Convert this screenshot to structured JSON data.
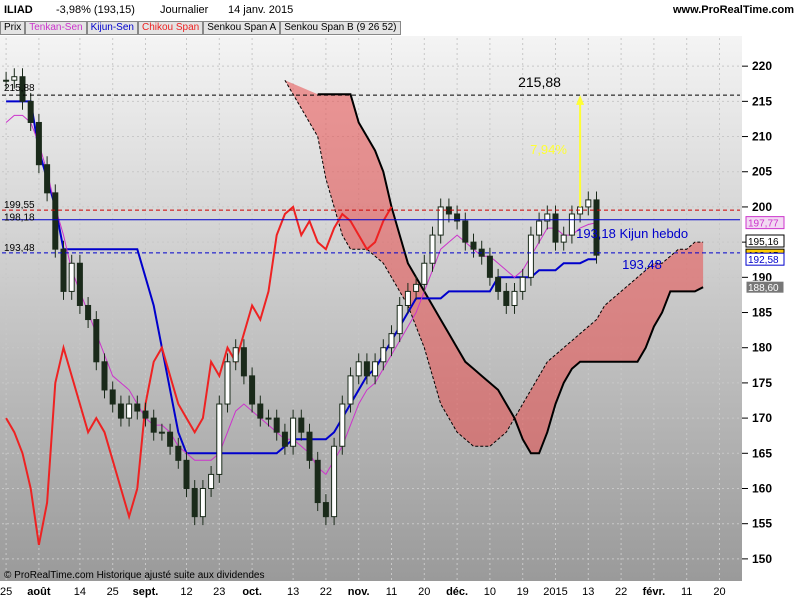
{
  "header": {
    "symbol": "ILIAD",
    "change": "-3,98% (193,15)",
    "period": "Journalier",
    "date": "14 janv. 2015",
    "site": "www.ProRealTime.com"
  },
  "legend": [
    {
      "label": "Prix",
      "color": "#000000"
    },
    {
      "label": "Tenkan-Sen",
      "color": "#cc33cc"
    },
    {
      "label": "Kijun-Sen",
      "color": "#0000cc"
    },
    {
      "label": "Chikou Span",
      "color": "#ee2222"
    },
    {
      "label": "Senkou Span A",
      "color": "#000000"
    },
    {
      "label": "Senkou Span B (9 26 52)",
      "color": "#000000"
    }
  ],
  "footer": "© ProRealTime.com  Historique ajusté suite aux dividendes",
  "annotations": {
    "target": "215,88",
    "percent": "7,94%",
    "kijun_hebdo": "193,18 Kijun hebdo",
    "support": "193,48",
    "left_215": "215,88",
    "left_19955": "199,55",
    "left_19818": "198,18",
    "left_19348": "193,48"
  },
  "price_tags": [
    {
      "text": "197,77",
      "value": 197.77,
      "color": "#cc33cc",
      "fill": "#f2d9f2"
    },
    {
      "text": "195,16",
      "value": 195.16,
      "color": "#000000",
      "fill": "#ffffff"
    },
    {
      "text": "193,15",
      "value": 193.15,
      "color": "#000000",
      "fill": "#ffcc00"
    },
    {
      "text": "192,58",
      "value": 192.58,
      "color": "#0000cc",
      "fill": "#ffffff"
    },
    {
      "text": "188,60",
      "value": 188.6,
      "color": "#ffffff",
      "fill": "#777777"
    }
  ],
  "colors": {
    "bull_cloud": "#6f9a55",
    "bear_cloud": "#e84c4c",
    "tenkan": "#cc33cc",
    "kijun": "#0000cc",
    "chikou": "#ee2222",
    "target_arrow": "#ffff33"
  },
  "chart_data": {
    "type": "line",
    "title": "ILIAD",
    "ylim": [
      147,
      224
    ],
    "y_ticks": [
      150,
      155,
      160,
      165,
      170,
      175,
      180,
      185,
      190,
      195,
      200,
      205,
      210,
      215,
      220
    ],
    "x_ticks": [
      "25",
      "août",
      "14",
      "25",
      "sept.",
      "12",
      "23",
      "oct.",
      "13",
      "22",
      "nov.",
      "11",
      "20",
      "déc.",
      "10",
      "19",
      "2015",
      "13",
      "22",
      "févr.",
      "11",
      "20"
    ],
    "x_index": [
      0,
      4,
      9,
      13,
      17,
      22,
      26,
      30,
      35,
      39,
      43,
      47,
      51,
      55,
      59,
      63,
      67,
      71,
      75,
      79,
      83,
      87
    ],
    "x_count": 90,
    "candles_close": [
      218,
      218.5,
      215,
      212,
      206,
      202,
      194,
      188,
      192,
      186,
      184,
      178,
      174,
      172,
      170,
      172,
      171,
      170,
      168,
      168,
      166,
      164,
      160,
      156,
      160,
      162,
      172,
      178,
      180,
      176,
      172,
      170,
      170,
      168,
      166,
      170,
      168,
      164,
      158,
      156,
      166,
      172,
      176,
      178,
      176,
      178,
      180,
      182,
      186,
      188,
      189,
      192,
      196,
      200,
      199,
      198,
      195,
      194,
      193,
      190,
      188,
      186,
      188,
      190,
      196,
      198,
      199,
      195,
      196,
      199,
      200,
      201,
      193.15
    ],
    "tenkan": [
      212,
      213,
      213,
      212,
      209,
      205,
      200,
      196,
      191,
      188,
      185,
      182,
      179,
      176,
      175,
      174,
      172,
      170,
      169,
      169,
      168,
      166,
      165,
      164,
      164,
      164,
      165,
      168,
      171,
      172,
      171,
      170,
      169,
      168,
      167,
      167,
      166,
      165,
      163,
      162,
      164,
      166,
      169,
      172,
      174,
      175,
      177,
      179,
      181,
      183,
      185,
      188,
      191,
      194,
      195,
      196,
      195,
      194,
      193,
      193,
      192,
      191,
      190,
      191,
      193,
      195,
      197,
      197,
      196,
      196,
      197,
      197.5,
      197.77
    ],
    "kijun": [
      215,
      215,
      215,
      215,
      208,
      204,
      200,
      194,
      194,
      194,
      194,
      194,
      194,
      194,
      194,
      194,
      194,
      190,
      186,
      180,
      174,
      168,
      165,
      165,
      165,
      165,
      165,
      165,
      165,
      165,
      165,
      165,
      165,
      165,
      166,
      167,
      167,
      167,
      167,
      167,
      168,
      170,
      172,
      174,
      176,
      177,
      179,
      181,
      183,
      185,
      187,
      187,
      187,
      187,
      188,
      188,
      188,
      188,
      188,
      188,
      190,
      190,
      190,
      190,
      190,
      191,
      191,
      191,
      192,
      192,
      192,
      192.58,
      192.58
    ],
    "chikou": [
      170,
      168,
      165,
      160,
      152,
      158,
      175,
      180,
      176,
      172,
      168,
      170,
      168,
      164,
      160,
      156,
      160,
      172,
      178,
      180,
      176,
      172,
      170,
      168,
      170,
      178,
      176,
      180,
      178,
      182,
      186,
      184,
      188,
      196,
      199,
      200,
      196,
      198,
      195,
      194,
      197,
      199,
      198,
      196,
      194,
      195,
      198,
      200
    ],
    "senkou_a": [
      218,
      216,
      214,
      212,
      210,
      204,
      200,
      196,
      194,
      194,
      194,
      193,
      192,
      190,
      188,
      186,
      183,
      180,
      176,
      172,
      170,
      168,
      167,
      166,
      166,
      166,
      167,
      168,
      170,
      172,
      174,
      176,
      178,
      179,
      180,
      181,
      182,
      183,
      184,
      186,
      187,
      188,
      189,
      190,
      191,
      192,
      192,
      193,
      194,
      194,
      195,
      195
    ],
    "senkou_b": [
      216,
      216,
      216,
      216,
      216,
      212,
      210,
      208,
      205,
      200,
      196,
      192,
      190,
      188,
      186,
      184,
      182,
      180,
      178,
      177,
      176,
      175,
      174,
      172,
      170,
      167,
      165,
      165,
      168,
      172,
      175,
      177,
      178,
      178,
      178,
      178,
      178,
      178,
      178,
      178,
      180,
      183,
      185,
      188,
      188,
      188,
      188,
      188.6
    ],
    "series": [
      {
        "name": "Prix"
      },
      {
        "name": "Tenkan-Sen"
      },
      {
        "name": "Kijun-Sen"
      },
      {
        "name": "Chikou Span"
      },
      {
        "name": "Senkou Span A"
      },
      {
        "name": "Senkou Span B (9 26 52)"
      }
    ],
    "grid": true,
    "legend_position": "top-left"
  }
}
